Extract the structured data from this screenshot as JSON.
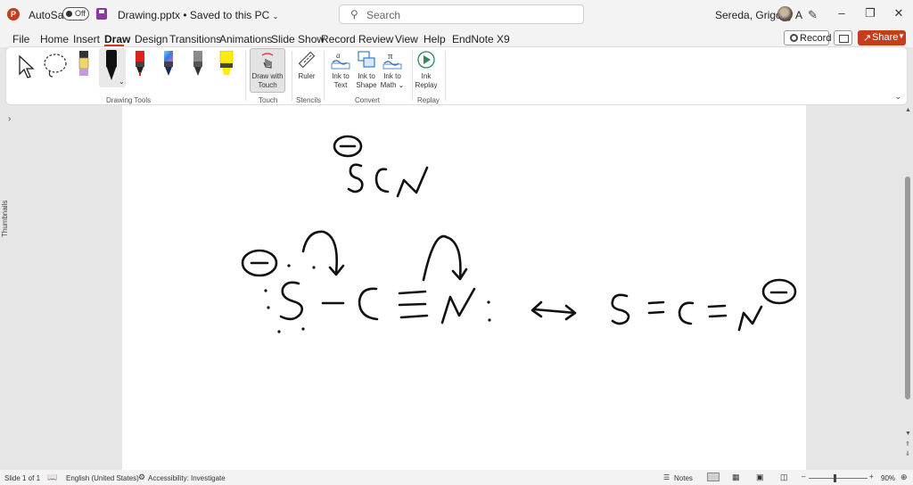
{
  "titlebar": {
    "autosave_label": "AutoSave",
    "autosave_state": "Off",
    "document": "Drawing.pptx • Saved to this PC",
    "search_placeholder": "Search",
    "user": "Sereda, Grigoriy A"
  },
  "menu": {
    "tabs": [
      "File",
      "Home",
      "Insert",
      "Draw",
      "Design",
      "Transitions",
      "Animations",
      "Slide Show",
      "Record",
      "Review",
      "View",
      "Help",
      "EndNote X9"
    ],
    "active_tab": "Draw",
    "record_label": "Record",
    "share_label": "Share"
  },
  "ribbon": {
    "groups": {
      "drawing_tools": "Drawing Tools",
      "touch": "Touch",
      "stencils": "Stencils",
      "convert": "Convert",
      "replay": "Replay"
    },
    "buttons": {
      "draw_with_touch": [
        "Draw with",
        "Touch"
      ],
      "ruler": "Ruler",
      "ink_to_text": [
        "Ink to",
        "Text"
      ],
      "ink_to_shape": [
        "Ink to",
        "Shape"
      ],
      "ink_to_math": [
        "Ink to",
        "Math"
      ],
      "ink_replay": [
        "Ink",
        "Replay"
      ]
    },
    "pens": [
      {
        "name": "pencil-highlighter",
        "color": "#f3d36b",
        "tip": "#c59be0"
      },
      {
        "name": "black-pen",
        "color": "#111111",
        "tip": "#111111"
      },
      {
        "name": "red-pen",
        "color": "#e02020",
        "tip": "#e02020"
      },
      {
        "name": "galaxy-pen",
        "color": "#3a7bd5",
        "tip": "#1b2a5a"
      },
      {
        "name": "gray-pen",
        "color": "#8a8a8a",
        "tip": "#444444"
      },
      {
        "name": "yellow-highlighter",
        "color": "#ffee00",
        "tip": "#ffee00"
      }
    ]
  },
  "left_rail": {
    "label": "Thumbnails"
  },
  "slide": {
    "top_formula": "SCN",
    "resonance_left": "S-C≡N:",
    "resonance_right": "S=C=N",
    "charge": "⊖"
  },
  "statusbar": {
    "slide": "Slide 1 of 1",
    "language": "English (United States)",
    "accessibility": "Accessibility: Investigate",
    "notes": "Notes",
    "zoom": "90%"
  }
}
